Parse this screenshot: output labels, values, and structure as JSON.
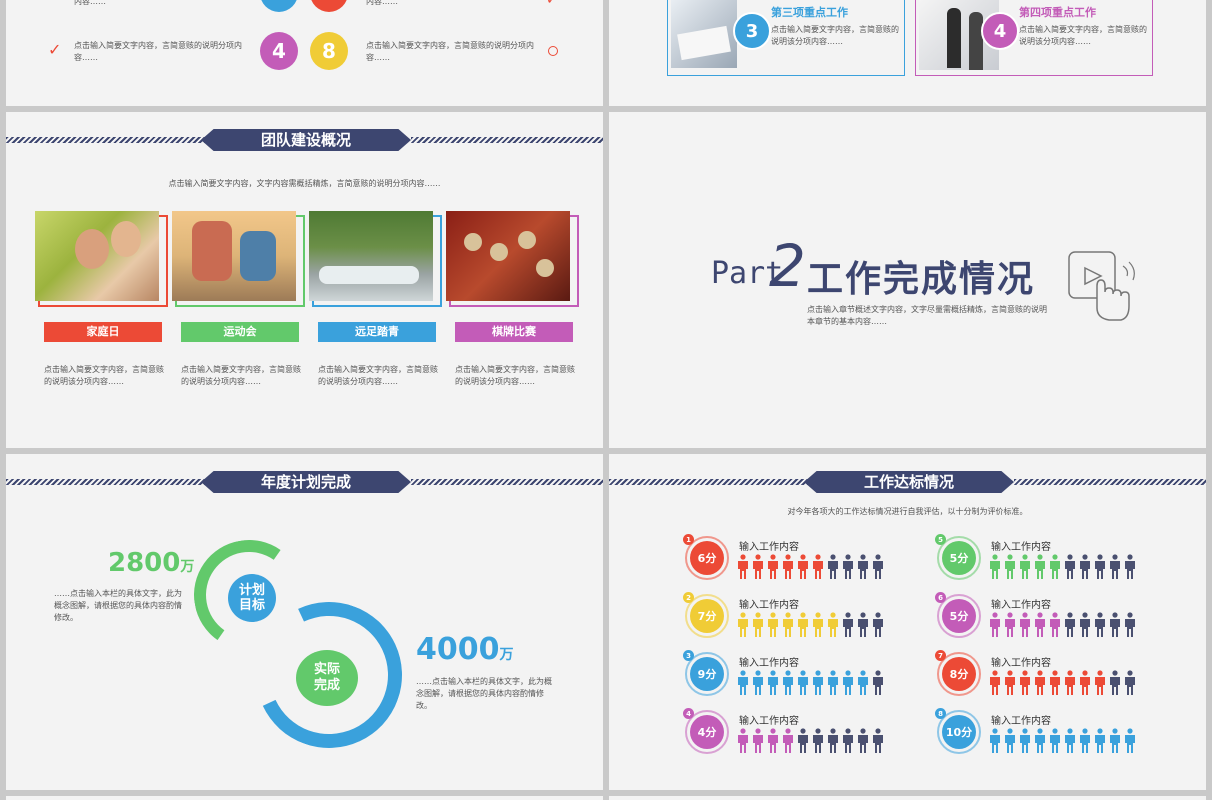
{
  "slide_top_left": {
    "left_items": [
      {
        "text": "点击输入简要文字内容，言简意赅的说明分项内容……",
        "mark": "check"
      }
    ],
    "numbers": [
      {
        "value": "4",
        "color": "#c35cb8"
      },
      {
        "value": "8",
        "color": "#f0cc36"
      }
    ],
    "right_items": [
      {
        "text": "点击输入简要文字内容，言简意赅的说明分项内容……"
      }
    ],
    "partial_top_text_left": "内容……",
    "partial_top_text_right": "内容……"
  },
  "slide_top_right": {
    "items": [
      {
        "number": "3",
        "title": "第三项重点工作",
        "text": "点击输入简要文字内容，言简意赅的说明该分项内容……",
        "color": "#3aa1dc"
      },
      {
        "number": "4",
        "title": "第四项重点工作",
        "text": "点击输入简要文字内容，言简意赅的说明该分项内容……",
        "color": "#c35cb8"
      }
    ]
  },
  "slide_team": {
    "title": "团队建设概况",
    "subtitle": "点击输入简要文字内容，文字内容需概括精炼，言简意赅的说明分项内容……",
    "cards": [
      {
        "tag": "家庭日",
        "color": "#ec4a36",
        "text": "点击输入简要文字内容，言简意赅的说明该分项内容……"
      },
      {
        "tag": "运动会",
        "color": "#62c96b",
        "text": "点击输入简要文字内容，言简意赅的说明该分项内容……"
      },
      {
        "tag": "远足踏青",
        "color": "#3aa1dc",
        "text": "点击输入简要文字内容，言简意赅的说明该分项内容……"
      },
      {
        "tag": "棋牌比赛",
        "color": "#c35cb8",
        "text": "点击输入简要文字内容，言简意赅的说明该分项内容……"
      }
    ]
  },
  "slide_part2": {
    "part_word": "Part",
    "part_number": "2",
    "title": "工作完成情况",
    "text": "点击输入章节概述文字内容，文字尽量需概括精炼，言简意赅的说明本章节的基本内容……"
  },
  "slide_annual": {
    "title": "年度计划完成",
    "plan_value": "2800",
    "plan_unit": "万",
    "plan_text": "……点击输入本栏的具体文字，此为概念图解，请根据您的具体内容酌情修改。",
    "plan_label": "计划\n目标",
    "actual_value": "4000",
    "actual_unit": "万",
    "actual_text": "……点击输入本栏的具体文字，此为概念图解，请根据您的具体内容酌情修改。",
    "actual_label": "实际\n完成"
  },
  "slide_standard": {
    "title": "工作达标情况",
    "subtitle": "对今年各项大的工作达标情况进行自我评估，以十分制为评价标准。",
    "items": [
      {
        "index": "1",
        "score": "6分",
        "score_value": 6,
        "label": "输入工作内容",
        "color": "#ec4a36"
      },
      {
        "index": "2",
        "score": "7分",
        "score_value": 7,
        "label": "输入工作内容",
        "color": "#f0cc36"
      },
      {
        "index": "3",
        "score": "9分",
        "score_value": 9,
        "label": "输入工作内容",
        "color": "#3aa1dc"
      },
      {
        "index": "4",
        "score": "4分",
        "score_value": 4,
        "label": "输入工作内容",
        "color": "#c35cb8"
      },
      {
        "index": "5",
        "score": "5分",
        "score_value": 5,
        "label": "输入工作内容",
        "color": "#62c96b"
      },
      {
        "index": "6",
        "score": "5分",
        "score_value": 5,
        "label": "输入工作内容",
        "color": "#c35cb8"
      },
      {
        "index": "7",
        "score": "8分",
        "score_value": 8,
        "label": "输入工作内容",
        "color": "#ec4a36"
      },
      {
        "index": "8",
        "score": "10分",
        "score_value": 10,
        "label": "输入工作内容",
        "color": "#3aa1dc"
      }
    ],
    "gray_color": "#4a5070"
  }
}
